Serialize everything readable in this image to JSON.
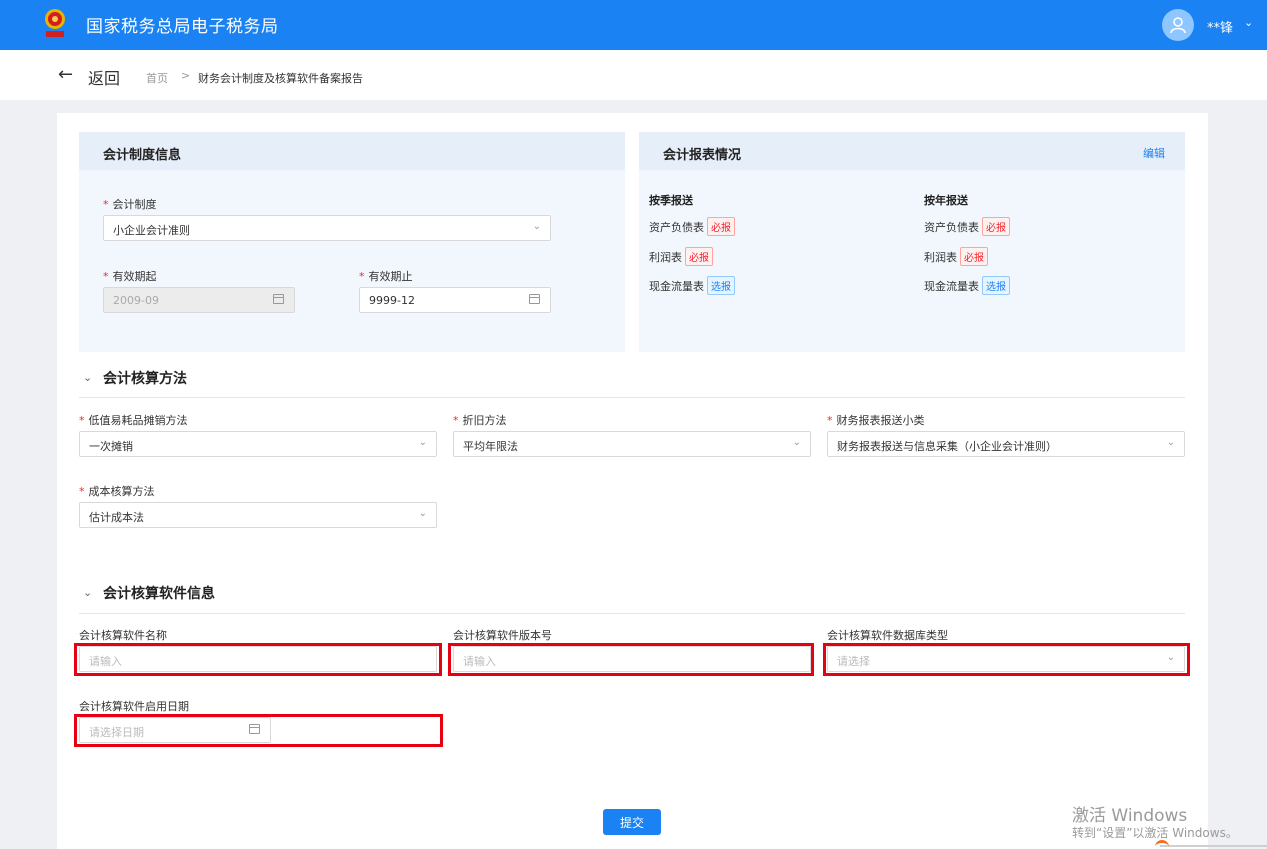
{
  "header": {
    "site_title": "国家税务总局电子税务局",
    "user_name": "**锋",
    "user_caret": "⌄"
  },
  "subnav": {
    "back_label": "返回",
    "breadcrumb": {
      "home": "首页",
      "separator": ">",
      "current": "财务会计制度及核算软件备案报告"
    }
  },
  "accounting_system": {
    "title": "会计制度信息",
    "system_label": "会计制度",
    "system_value": "小企业会计准则",
    "valid_from_label": "有效期起",
    "valid_from_value": "2009-09",
    "valid_to_label": "有效期止",
    "valid_to_value": "9999-12"
  },
  "reports": {
    "title": "会计报表情况",
    "edit_label": "编辑",
    "quarterly": {
      "heading": "按季报送",
      "items": [
        {
          "name": "资产负债表",
          "tag": "必报"
        },
        {
          "name": "利润表",
          "tag": "必报"
        },
        {
          "name": "现金流量表",
          "tag": "选报"
        }
      ]
    },
    "annual": {
      "heading": "按年报送",
      "items": [
        {
          "name": "资产负债表",
          "tag": "必报"
        },
        {
          "name": "利润表",
          "tag": "必报"
        },
        {
          "name": "现金流量表",
          "tag": "选报"
        }
      ]
    }
  },
  "method": {
    "title": "会计核算方法",
    "low_value_label": "低值易耗品摊销方法",
    "low_value_value": "一次摊销",
    "depreciation_label": "折旧方法",
    "depreciation_value": "平均年限法",
    "report_category_label": "财务报表报送小类",
    "report_category_value": "财务报表报送与信息采集（小企业会计准则）",
    "cost_label": "成本核算方法",
    "cost_value": "估计成本法"
  },
  "software": {
    "title": "会计核算软件信息",
    "name_label": "会计核算软件名称",
    "name_placeholder": "请输入",
    "version_label": "会计核算软件版本号",
    "version_placeholder": "请输入",
    "db_label": "会计核算软件数据库类型",
    "db_placeholder": "请选择",
    "start_date_label": "会计核算软件启用日期",
    "start_date_placeholder": "请选择日期"
  },
  "submit_label": "提交",
  "watermark": {
    "line1": "激活 Windows",
    "line2": "转到“设置”以激活 Windows。"
  },
  "colors": {
    "primary": "#1a82f2",
    "highlight": "#e60012",
    "required": "#f5222d"
  }
}
